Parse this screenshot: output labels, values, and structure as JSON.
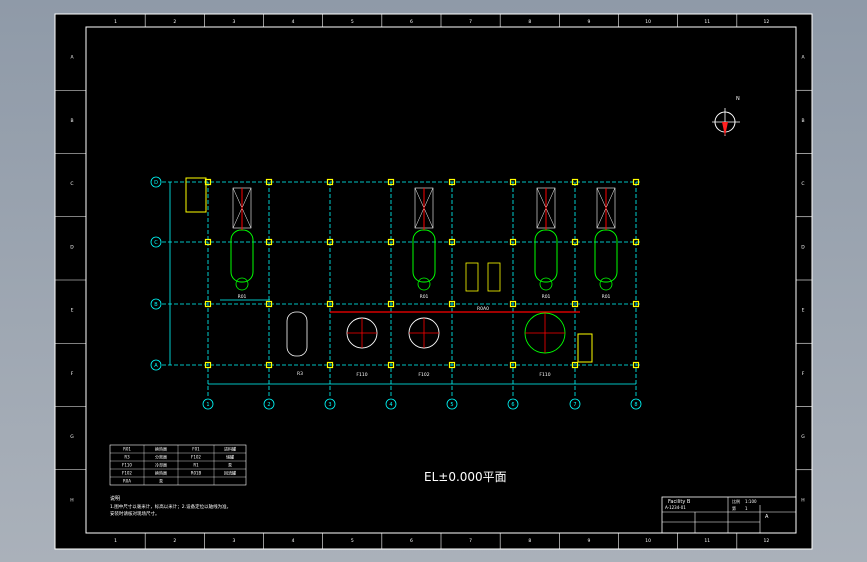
{
  "sheet": {
    "top_ruler": [
      "1",
      "2",
      "3",
      "4",
      "5",
      "6",
      "7",
      "8",
      "9",
      "10",
      "11",
      "12"
    ],
    "bottom_ruler": [
      "1",
      "2",
      "3",
      "4",
      "5",
      "6",
      "7",
      "8",
      "9",
      "10",
      "11",
      "12"
    ],
    "side_ruler": [
      "A",
      "B",
      "C",
      "D",
      "E",
      "F",
      "G",
      "H"
    ]
  },
  "plan": {
    "title": "EL±0.000平面",
    "row_axes": [
      "D",
      "C",
      "B",
      "A"
    ],
    "col_axes": [
      "1",
      "2",
      "3",
      "4",
      "5",
      "6",
      "7",
      "8"
    ],
    "equipment": {
      "exchangers": [
        "R01",
        "R01",
        "R01",
        "R01"
      ],
      "drum": "R3",
      "tanks": [
        "F110",
        "F102",
        "F110"
      ],
      "pump_label": "R0A0"
    }
  },
  "compass": {
    "north": "N"
  },
  "legend_table": {
    "rows": [
      [
        "R01",
        "换热器",
        "F01",
        "进料罐"
      ],
      [
        "R3",
        "分离器",
        "F102",
        "储罐"
      ],
      [
        "F110",
        "冷却器",
        "R1",
        "泵"
      ],
      [
        "F102",
        "换热器",
        "R01B",
        "回流罐"
      ],
      [
        "R0A",
        "泵",
        "",
        ""
      ]
    ]
  },
  "notes": {
    "heading": "说明",
    "line1": "1.图中尺寸以毫米计，标高以米计；2.设备定位以轴线为准，",
    "line2": "安装时请核对现场尺寸。"
  },
  "title_block": {
    "company": "Facility B",
    "drawing_no": "A-1234-01",
    "scale_label": "比例",
    "scale_value": "1:100",
    "sheet_label": "第",
    "sheet_value": "1",
    "rev": "A"
  },
  "colors": {
    "background": "#000000",
    "frame": "#ffffff",
    "grid_axis": "#00ffff",
    "equipment": "#00ff00",
    "pipe": "#ff0000",
    "column_marker": "#ffff00"
  }
}
